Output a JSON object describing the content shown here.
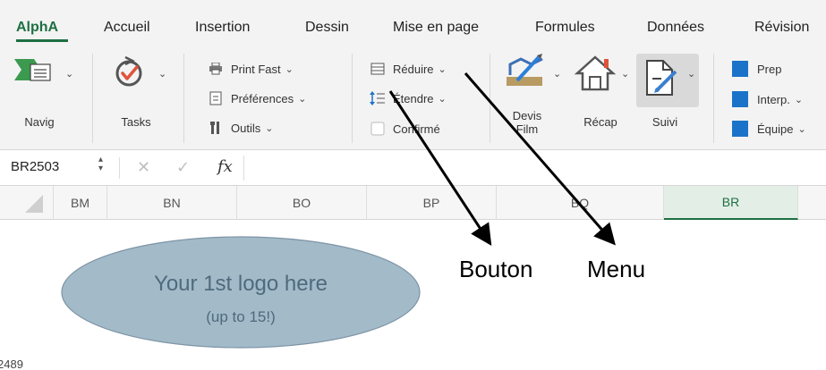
{
  "tabs": [
    {
      "label": "AlphA",
      "active": true
    },
    {
      "label": "Accueil"
    },
    {
      "label": "Insertion"
    },
    {
      "label": "Dessin"
    },
    {
      "label": "Mise en page"
    },
    {
      "label": "Formules"
    },
    {
      "label": "Données"
    },
    {
      "label": "Révision"
    }
  ],
  "ribbon": {
    "navig_label": "Navig",
    "tasks_label": "Tasks",
    "print_fast": "Print Fast",
    "preferences": "Préférences",
    "outils": "Outils",
    "reduire": "Réduire",
    "etendre": "Étendre",
    "confirme": "Confirmé",
    "devis_film_line1": "Devis",
    "devis_film_line2": "Film",
    "recap": "Récap",
    "suivi": "Suivi",
    "prep": "Prep",
    "interp": "Interp.",
    "equipe": "Équipe",
    "accent_color": "#1d6f42",
    "square_color": "#1a73c8"
  },
  "formula_bar": {
    "name_box": "BR2503",
    "fx": "fx"
  },
  "columns": [
    {
      "label": "BM"
    },
    {
      "label": "BN"
    },
    {
      "label": "BO"
    },
    {
      "label": "BP"
    },
    {
      "label": "BQ"
    },
    {
      "label": "BR",
      "active": true
    }
  ],
  "sheet": {
    "logo_line1": "Your 1st logo here",
    "logo_line2": "(up to 15!)",
    "logo_fill": "#a3bac9",
    "row_number": "2489"
  },
  "annotations": {
    "bouton": "Bouton",
    "menu": "Menu"
  }
}
